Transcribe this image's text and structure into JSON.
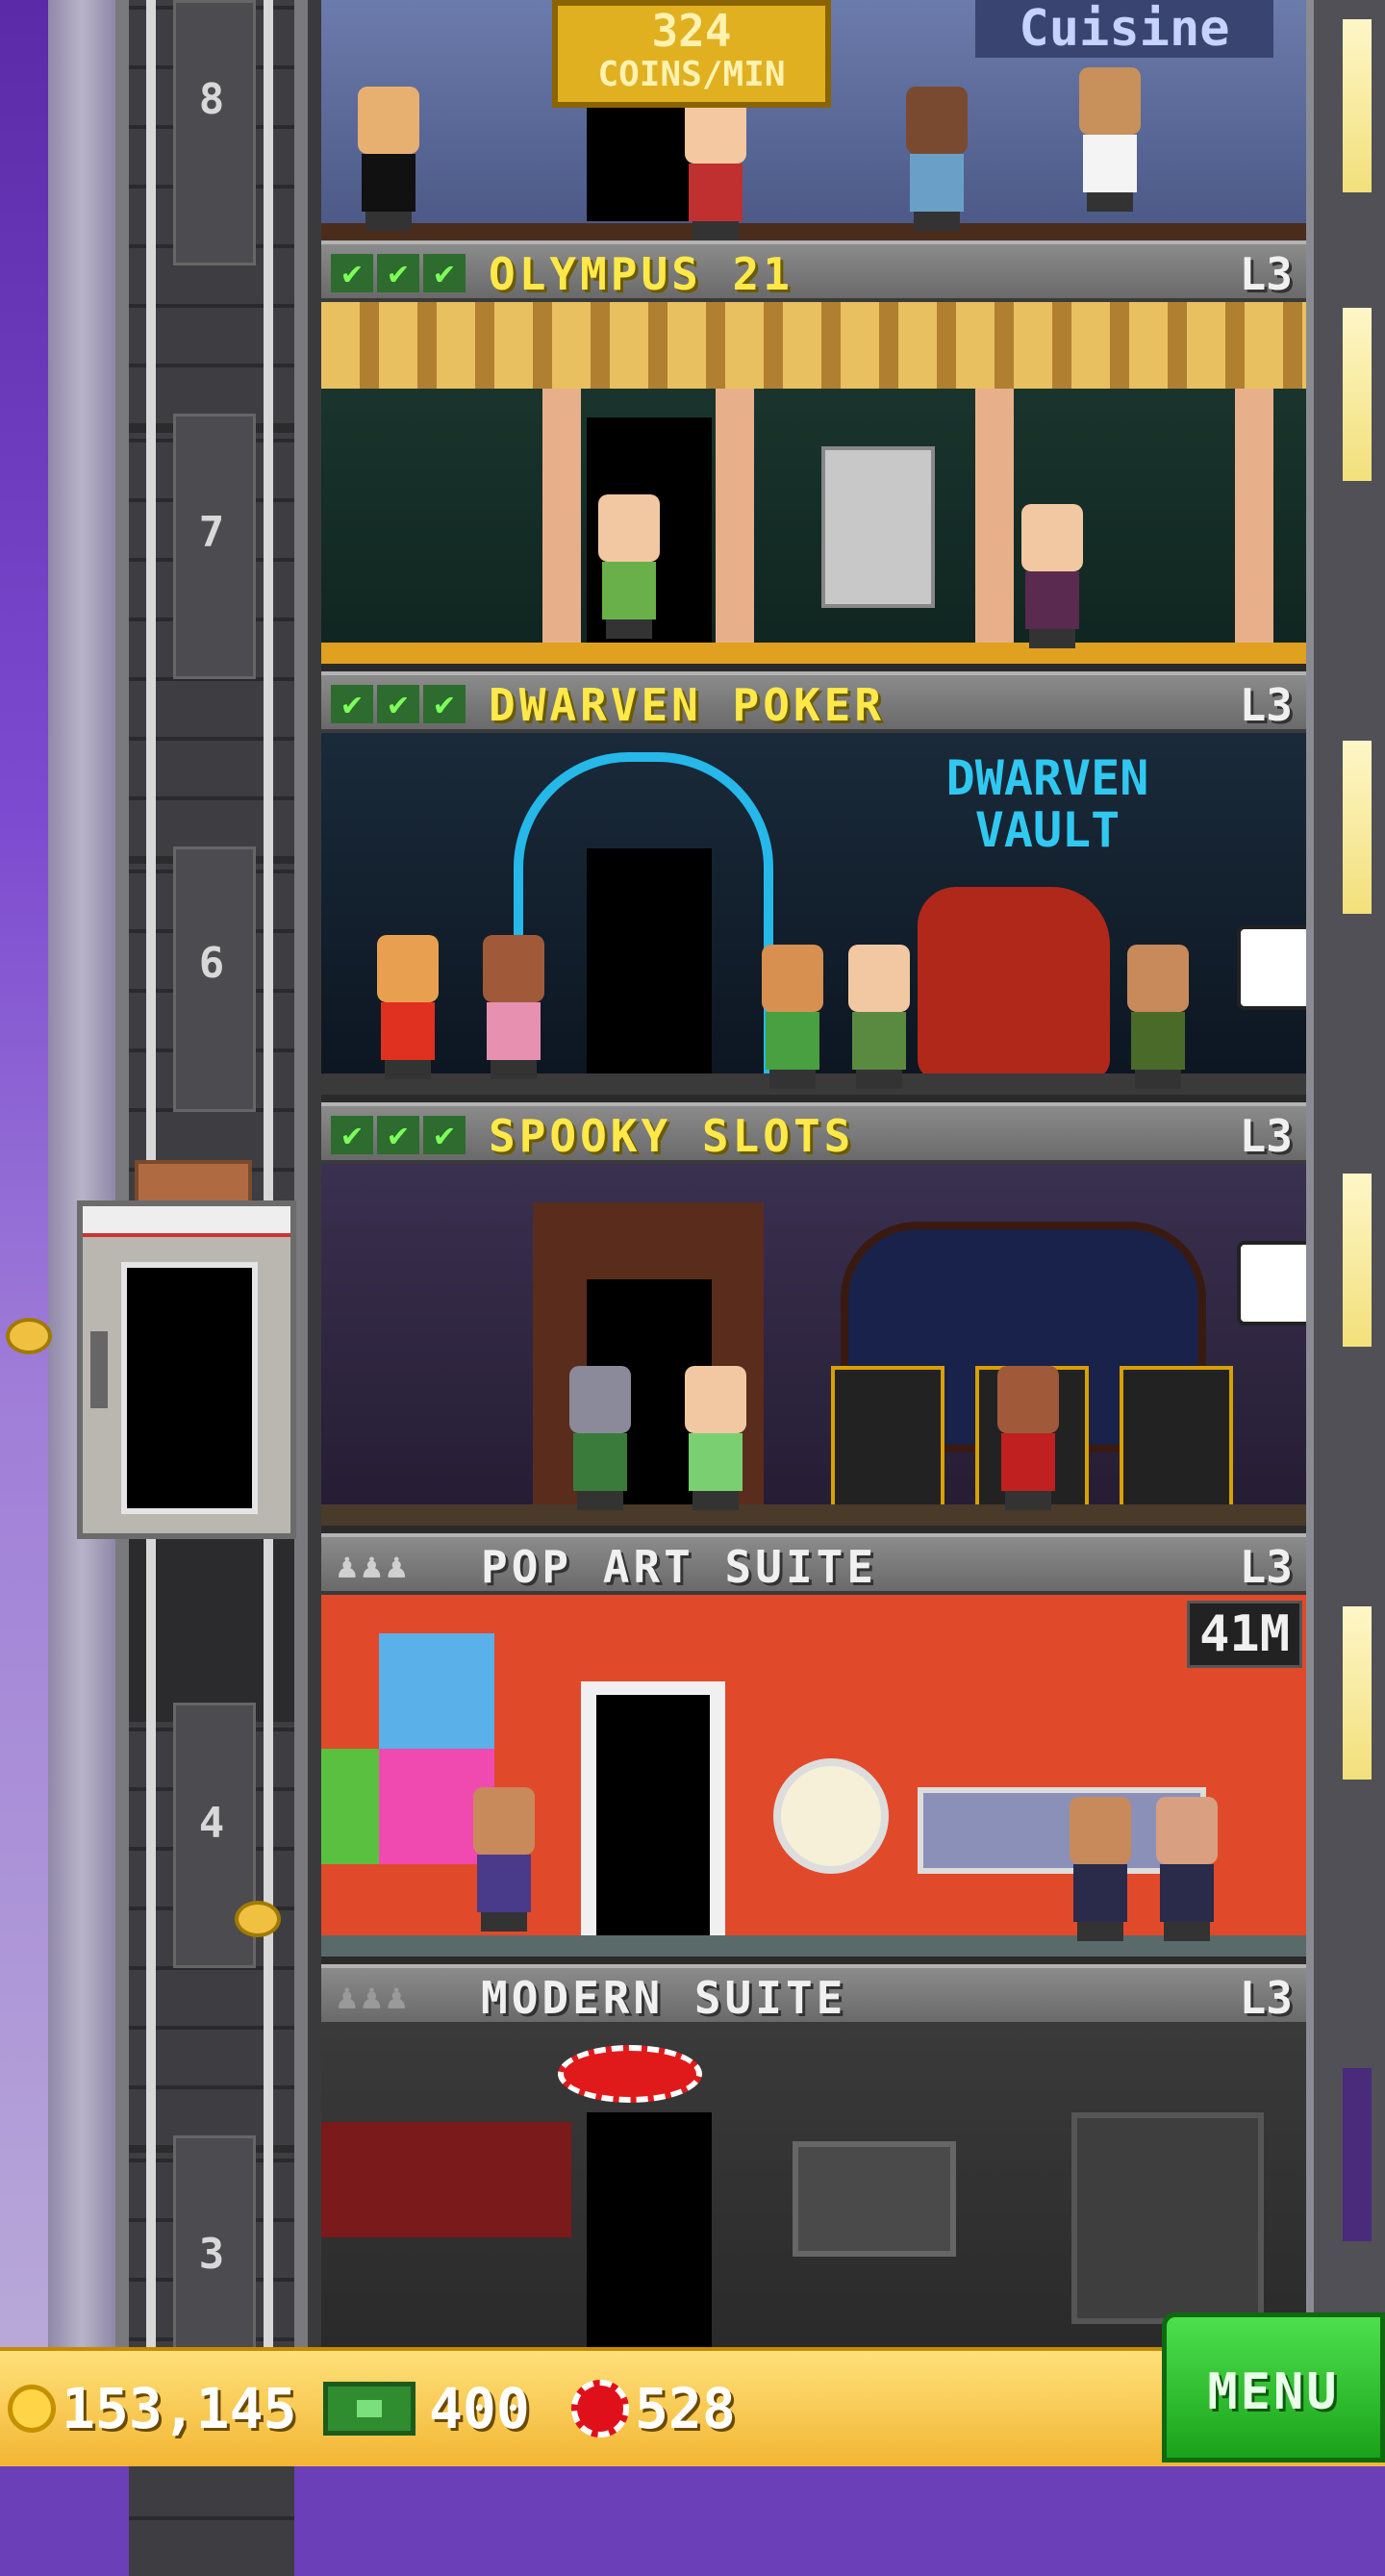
{
  "tower_income": {
    "value": "324",
    "unit": "COINS/MIN"
  },
  "shaft_floor_numbers": [
    "8",
    "7",
    "6",
    "4",
    "3"
  ],
  "rooms": [
    {
      "name": "OLYMPUS 21",
      "level": "L3",
      "stocked": true
    },
    {
      "name": "DWARVEN POKER",
      "level": "L3",
      "stocked": true,
      "sign_line1": "DWARVEN",
      "sign_line2": "VAULT"
    },
    {
      "name": "SPOOKY SLOTS",
      "level": "L3",
      "stocked": true
    },
    {
      "name": "POP ART SUITE",
      "level": "L3",
      "stocked": false,
      "income_tag": "41M"
    },
    {
      "name": "MODERN SUITE",
      "level": "L3",
      "stocked": false
    }
  ],
  "top_room_sign": "Cuisine",
  "resources": {
    "coins": "153,145",
    "bux": "400",
    "chips": "528"
  },
  "menu_label": "MENU",
  "colors": {
    "accent_gold": "#ffe94a",
    "menu_green": "#1aa21a",
    "bottom_bar": "#f2b633"
  }
}
